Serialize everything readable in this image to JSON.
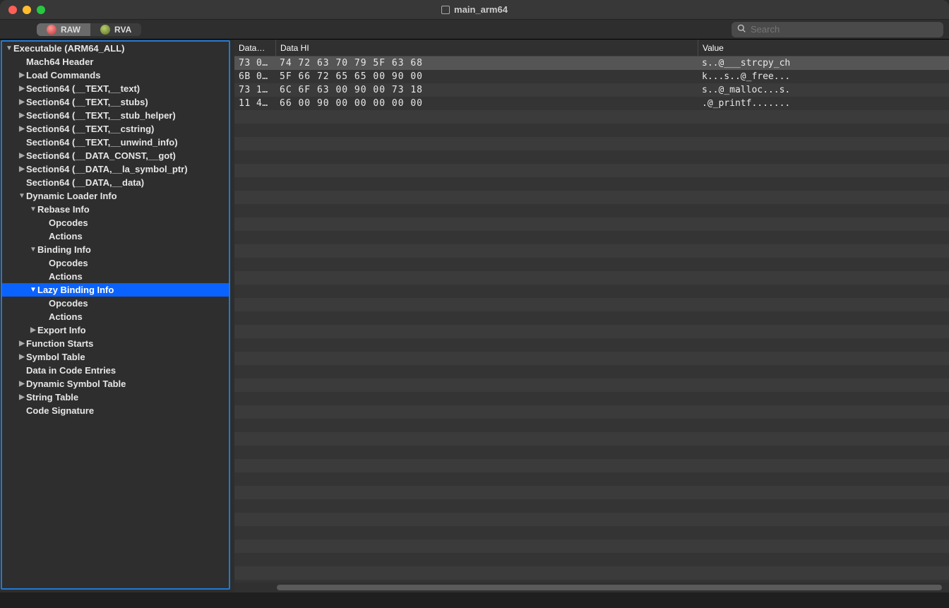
{
  "window": {
    "title": "main_arm64"
  },
  "toolbar": {
    "seg": {
      "raw": "RAW",
      "rva": "RVA"
    },
    "search_placeholder": "Search"
  },
  "tree": [
    {
      "label": "Executable  (ARM64_ALL)",
      "indent": 0,
      "arrow": "down"
    },
    {
      "label": "Mach64 Header",
      "indent": 1,
      "arrow": "none"
    },
    {
      "label": "Load Commands",
      "indent": 1,
      "arrow": "right"
    },
    {
      "label": "Section64 (__TEXT,__text)",
      "indent": 1,
      "arrow": "right"
    },
    {
      "label": "Section64 (__TEXT,__stubs)",
      "indent": 1,
      "arrow": "right"
    },
    {
      "label": "Section64 (__TEXT,__stub_helper)",
      "indent": 1,
      "arrow": "right"
    },
    {
      "label": "Section64 (__TEXT,__cstring)",
      "indent": 1,
      "arrow": "right"
    },
    {
      "label": "Section64 (__TEXT,__unwind_info)",
      "indent": 1,
      "arrow": "none"
    },
    {
      "label": "Section64 (__DATA_CONST,__got)",
      "indent": 1,
      "arrow": "right"
    },
    {
      "label": "Section64 (__DATA,__la_symbol_ptr)",
      "indent": 1,
      "arrow": "right"
    },
    {
      "label": "Section64 (__DATA,__data)",
      "indent": 1,
      "arrow": "none"
    },
    {
      "label": "Dynamic Loader Info",
      "indent": 1,
      "arrow": "down"
    },
    {
      "label": "Rebase Info",
      "indent": 2,
      "arrow": "down"
    },
    {
      "label": "Opcodes",
      "indent": 3,
      "arrow": "none"
    },
    {
      "label": "Actions",
      "indent": 3,
      "arrow": "none"
    },
    {
      "label": "Binding Info",
      "indent": 2,
      "arrow": "down"
    },
    {
      "label": "Opcodes",
      "indent": 3,
      "arrow": "none"
    },
    {
      "label": "Actions",
      "indent": 3,
      "arrow": "none"
    },
    {
      "label": "Lazy Binding Info",
      "indent": 2,
      "arrow": "down",
      "selected": true
    },
    {
      "label": "Opcodes",
      "indent": 3,
      "arrow": "none"
    },
    {
      "label": "Actions",
      "indent": 3,
      "arrow": "none"
    },
    {
      "label": "Export Info",
      "indent": 2,
      "arrow": "right"
    },
    {
      "label": "Function Starts",
      "indent": 1,
      "arrow": "right"
    },
    {
      "label": "Symbol Table",
      "indent": 1,
      "arrow": "right"
    },
    {
      "label": "Data in Code Entries",
      "indent": 1,
      "arrow": "none"
    },
    {
      "label": "Dynamic Symbol Table",
      "indent": 1,
      "arrow": "right"
    },
    {
      "label": "String Table",
      "indent": 1,
      "arrow": "right"
    },
    {
      "label": "Code Signature",
      "indent": 1,
      "arrow": "none"
    }
  ],
  "columns": {
    "a": "Data…",
    "b": "Data HI",
    "c": "Value"
  },
  "rows": [
    {
      "a": "73 0…",
      "b": "74 72 63 70 79 5F 63 68",
      "c": "s..@___strcpy_ch",
      "selected": true
    },
    {
      "a": "6B 0…",
      "b": "5F 66 72 65 65 00 90 00",
      "c": "k...s..@_free..."
    },
    {
      "a": "73 1…",
      "b": "6C 6F 63 00 90 00 73 18",
      "c": "s..@_malloc...s."
    },
    {
      "a": "11 4…",
      "b": "66 00 90 00 00 00 00 00",
      "c": ".@_printf......."
    }
  ],
  "empty_rows": 36
}
